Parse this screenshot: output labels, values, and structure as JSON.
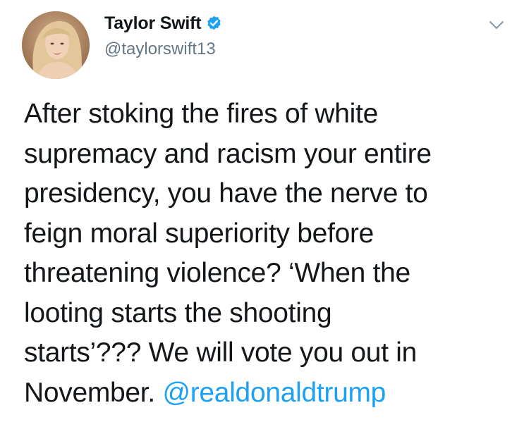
{
  "author": {
    "display_name": "Taylor Swift",
    "handle": "@taylorswift13",
    "verified": true
  },
  "tweet": {
    "lines": [
      "After stoking the fires of white",
      "supremacy and racism your entire",
      "presidency, you have the nerve to",
      "feign moral superiority before",
      "threatening violence? ‘When the",
      "looting starts the shooting",
      "starts’??? We will vote you out in"
    ],
    "last_line_text": "November.",
    "mention": "@realdonaldtrump"
  },
  "icons": {
    "verified": "verified-badge-icon",
    "menu": "chevron-down-icon"
  },
  "colors": {
    "text": "#14171a",
    "secondary": "#657786",
    "link": "#1da1f2",
    "verified": "#1da1f2"
  }
}
